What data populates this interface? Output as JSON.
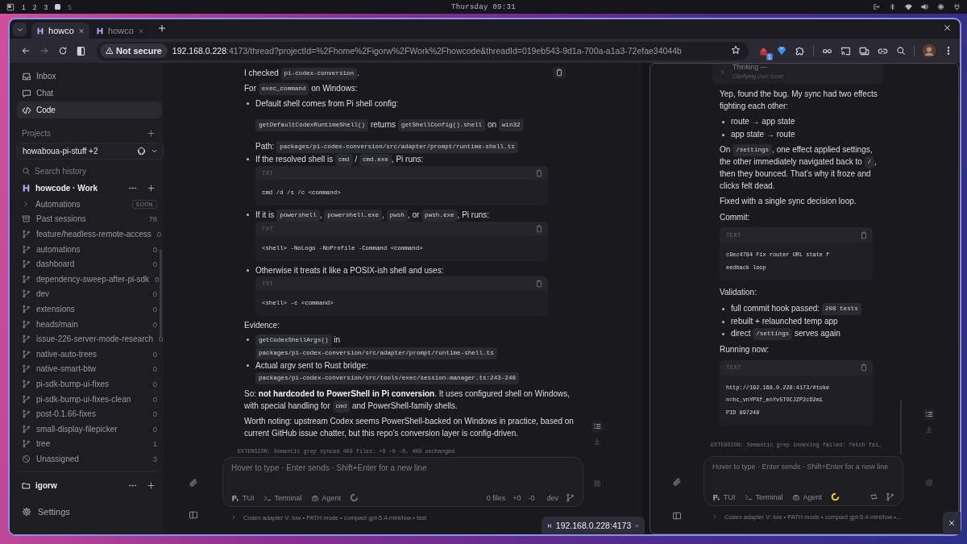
{
  "system_bar": {
    "workspaces": [
      {
        "label": "1",
        "selected": false
      },
      {
        "label": "2",
        "selected": false
      },
      {
        "label": "3",
        "selected": false
      },
      {
        "selected": true
      },
      {
        "label": "5",
        "selected": false
      }
    ],
    "clock": "Thursday 09:31"
  },
  "browser": {
    "tabs": [
      {
        "title": "howco",
        "selected": true
      },
      {
        "title": "howco",
        "selected": false
      }
    ],
    "security": "Not secure",
    "url_host": "192.168.0.228",
    "url_rest": ":4173/thread?projectId=%2Fhome%2Figorw%2FWork%2Fhowcode&threadId=019eb543-9d1a-700a-a1a3-72efae34044b",
    "extension_badge": "1"
  },
  "sidebar": {
    "nav": [
      {
        "kind": "inbox",
        "label": "Inbox",
        "selected": false
      },
      {
        "kind": "chat",
        "label": "Chat",
        "selected": false
      },
      {
        "kind": "code",
        "label": "Code",
        "selected": true
      }
    ],
    "projects_heading": "Projects",
    "project_picker": "howaboua-pi-stuff +2",
    "search_placeholder": "Search history",
    "workspace_title": "howcode · Work",
    "items": [
      {
        "kind": "automations",
        "label": "Automations",
        "badge": "SOON"
      },
      {
        "kind": "sessions",
        "label": "Past sessions",
        "count": "78"
      },
      {
        "kind": "branch",
        "label": "feature/headless-remote-access",
        "count": "0"
      },
      {
        "kind": "branch",
        "label": "automations",
        "count": "0"
      },
      {
        "kind": "branch",
        "label": "dashboard",
        "count": "0"
      },
      {
        "kind": "branch",
        "label": "dependency-sweep-after-pi-sdk",
        "count": "0"
      },
      {
        "kind": "branch",
        "label": "dev",
        "count": "0"
      },
      {
        "kind": "branch",
        "label": "extensions",
        "count": "0"
      },
      {
        "kind": "branch",
        "label": "heads/main",
        "count": "0"
      },
      {
        "kind": "branch",
        "label": "issue-226-server-mode-research",
        "count": "0"
      },
      {
        "kind": "branch",
        "label": "native-auto-trees",
        "count": "0"
      },
      {
        "kind": "branch",
        "label": "native-smart-btw",
        "count": "0"
      },
      {
        "kind": "branch",
        "label": "pi-sdk-bump-ui-fixes",
        "count": "0"
      },
      {
        "kind": "branch",
        "label": "pi-sdk-bump-ui-fixes-clean",
        "count": "0"
      },
      {
        "kind": "branch",
        "label": "post-0.1.66-fixes",
        "count": "0"
      },
      {
        "kind": "branch",
        "label": "small-display-filepicker",
        "count": "0"
      },
      {
        "kind": "branch",
        "label": "tree",
        "count": "1"
      },
      {
        "kind": "unassigned",
        "label": "Unassigned",
        "count": "3"
      }
    ],
    "folder_title": "igorw",
    "settings": "Settings"
  },
  "main_thread": {
    "blocks": [
      {
        "kind": "paragraph",
        "parts": [
          {
            "text": "I checked "
          },
          {
            "code": "pi-codex-conversion"
          },
          {
            "text": "."
          }
        ]
      },
      {
        "kind": "paragraph",
        "parts": [
          {
            "text": "For "
          },
          {
            "code": "exec_command"
          },
          {
            "text": " on Windows:"
          }
        ]
      },
      {
        "kind": "list",
        "items": [
          {
            "parts": [
              {
                "text": "Default shell comes from Pi shell config:"
              }
            ],
            "blocks": [
              {
                "kind": "paragraph",
                "parts": [
                  {
                    "code": "getDefaultCodexRuntimeShell()"
                  },
                  {
                    "text": " returns "
                  },
                  {
                    "code": "getShellConfig().shell"
                  },
                  {
                    "text": " on "
                  },
                  {
                    "code": "win32"
                  }
                ]
              },
              {
                "kind": "paragraph",
                "parts": [
                  {
                    "text": "Path: "
                  },
                  {
                    "code": "packages/pi-codex-conversion/src/adapter/prompt/runtime-shell.ts"
                  }
                ]
              }
            ]
          },
          {
            "parts": [
              {
                "text": "If the resolved shell is "
              },
              {
                "code": "cmd"
              },
              {
                "text": " / "
              },
              {
                "code": "cmd.exe"
              },
              {
                "text": ", Pi runs:"
              }
            ],
            "blocks": [
              {
                "kind": "code",
                "language": "TXT",
                "lines": [
                  "cmd /d /s /c <command>"
                ]
              }
            ]
          },
          {
            "parts": [
              {
                "text": "If it is "
              },
              {
                "code": "powershell"
              },
              {
                "text": ", "
              },
              {
                "code": "powershell.exe"
              },
              {
                "text": ", "
              },
              {
                "code": "pwsh"
              },
              {
                "text": ", or "
              },
              {
                "code": "pwsh.exe"
              },
              {
                "text": ", Pi runs:"
              }
            ],
            "blocks": [
              {
                "kind": "code",
                "language": "TXT",
                "lines": [
                  "<shell> -NoLogo -NoProfile -Command <command>"
                ]
              }
            ]
          },
          {
            "parts": [
              {
                "text": "Otherwise it treats it like a POSIX-ish shell and uses:"
              }
            ],
            "blocks": [
              {
                "kind": "code",
                "language": "TXT",
                "lines": [
                  "<shell> -c <command>"
                ]
              }
            ]
          }
        ]
      },
      {
        "kind": "paragraph",
        "parts": [
          {
            "text": "Evidence:"
          }
        ]
      },
      {
        "kind": "list",
        "items": [
          {
            "parts": [
              {
                "code": "getCodexShellArgs()"
              },
              {
                "text": " in "
              },
              {
                "code": "packages/pi-codex-conversion/src/adapter/prompt/runtime-shell.ts"
              }
            ]
          },
          {
            "parts": [
              {
                "text": "Actual argv sent to Rust bridge: "
              },
              {
                "code": "packages/pi-codex-conversion/src/tools/exec/session-manager.ts:243-248"
              }
            ]
          }
        ]
      },
      {
        "kind": "paragraph",
        "parts": [
          {
            "text": "So: **not hardcoded to PowerShell in Pi conversion**. It uses configured shell on Windows, with special handling for "
          },
          {
            "code": "cmd"
          },
          {
            "text": " and PowerShell-family shells."
          }
        ]
      },
      {
        "kind": "paragraph",
        "parts": [
          {
            "text": "Worth noting: upstream Codex seems PowerShell-backed on Windows in practice, based on current GitHub issue chatter, but this repo’s conversion layer is config-driven."
          }
        ]
      }
    ],
    "extension_notice": "EXTENSION: Semantic grep synced 409 files: +0 ~0 -0, 409 unchanged",
    "composer": {
      "placeholder": "Hover to type · Enter sends · Shift+Enter for a new line",
      "modes": [
        {
          "kind": "tui",
          "label": "TUI"
        },
        {
          "kind": "terminal",
          "label": "Terminal"
        },
        {
          "kind": "agent",
          "label": "Agent"
        }
      ],
      "agent_running": false,
      "files": "0 files",
      "added": "+0",
      "removed": "-0",
      "branch": "dev"
    },
    "footer": "Codex adapter V: low • PATH mode • compact gpt-5.4-mini/low • fast"
  },
  "side_thread": {
    "thinking": {
      "title": "Thinking —",
      "subtitle": "Clarifying user issue"
    },
    "blocks": [
      {
        "kind": "paragraph",
        "parts": [
          {
            "text": "Yep, found the bug. My sync had two effects fighting each other:"
          }
        ]
      },
      {
        "kind": "list",
        "items": [
          {
            "parts": [
              {
                "text": "route → app state"
              }
            ]
          },
          {
            "parts": [
              {
                "text": "app state → route"
              }
            ]
          }
        ]
      },
      {
        "kind": "paragraph",
        "parts": [
          {
            "text": "On "
          },
          {
            "code": "/settings"
          },
          {
            "text": ", one effect applied settings, the other immediately navigated back to "
          },
          {
            "code": "/"
          },
          {
            "text": ", then they bounced. That’s why it froze and clicks felt dead."
          }
        ]
      },
      {
        "kind": "paragraph",
        "parts": [
          {
            "text": "Fixed with a single sync decision loop."
          }
        ]
      },
      {
        "kind": "paragraph",
        "parts": [
          {
            "text": "Commit:"
          }
        ]
      },
      {
        "kind": "code",
        "language": "TEXT",
        "lines": [
          "c9ec4784 Fix router URL state f",
          "eedback loop"
        ]
      },
      {
        "kind": "paragraph",
        "parts": [
          {
            "text": "Validation:"
          }
        ]
      },
      {
        "kind": "list",
        "items": [
          {
            "parts": [
              {
                "text": "full commit hook passed: "
              },
              {
                "code": "208 tests"
              }
            ]
          },
          {
            "parts": [
              {
                "text": "rebuilt + relaunched temp app"
              }
            ]
          },
          {
            "parts": [
              {
                "text": "direct "
              },
              {
                "code": "/settings"
              },
              {
                "text": " serves again"
              }
            ]
          }
        ]
      },
      {
        "kind": "paragraph",
        "parts": [
          {
            "text": "Running now:"
          }
        ]
      },
      {
        "kind": "code",
        "language": "TEXT",
        "lines": [
          "http://192.168.0.228:4173/#toke",
          "n=hc_vnYPXf_enYv5TOCJZP2cD2mi",
          "PID 897248"
        ]
      }
    ],
    "extension_notice": "EXTENSION: Semantic grep indexing failed: fetch fai…",
    "composer": {
      "placeholder": "Hover to type · Enter sends · Shift+Enter for a new line",
      "modes": [
        {
          "kind": "tui",
          "label": "TUI"
        },
        {
          "kind": "terminal",
          "label": "Terminal"
        },
        {
          "kind": "agent",
          "label": "Agent"
        }
      ],
      "agent_running": true
    },
    "footer": "Codex adapter V: low • PATH mode • compact gpt-5.4-mini/low •…"
  },
  "tab_bubble": {
    "title": "192.168.0.228:4173"
  }
}
